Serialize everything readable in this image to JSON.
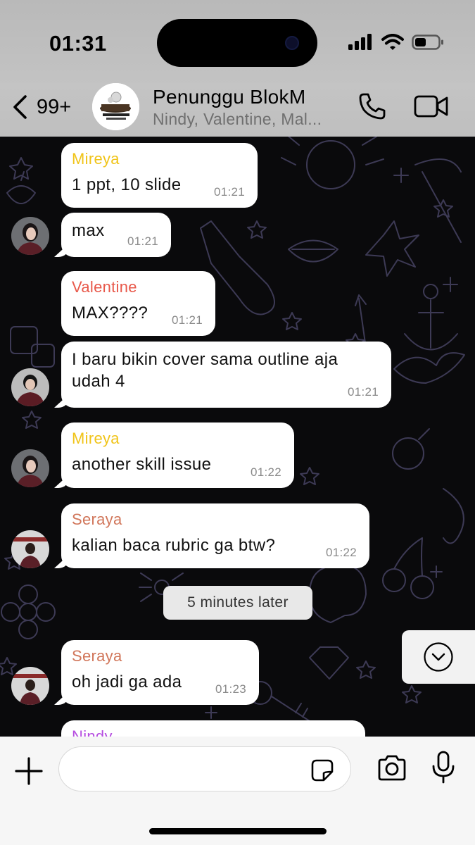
{
  "status_bar": {
    "time": "01:31",
    "icons": [
      "cellular-signal-icon",
      "wifi-icon",
      "battery-icon"
    ]
  },
  "header": {
    "back_icon": "chevron-left-icon",
    "back_count": "99+",
    "group_title": "Penunggu BlokM",
    "members_subtitle": "Nindy, Valentine, Mal...",
    "call_icon": "phone-icon",
    "video_icon": "video-camera-icon"
  },
  "messages": [
    {
      "sender": "Mireya",
      "sender_color": "#f0c419",
      "text": "1 ppt, 10 slide",
      "time": "01:21"
    },
    {
      "sender": "",
      "text": "max",
      "time": "01:21"
    },
    {
      "sender": "Valentine",
      "sender_color": "#e8584a",
      "text": "MAX????",
      "time": "01:21"
    },
    {
      "sender": "",
      "text": "I baru bikin cover sama outline aja udah 4",
      "time": "01:21"
    },
    {
      "sender": "Mireya",
      "sender_color": "#f0c419",
      "text": "another skill issue",
      "time": "01:22"
    },
    {
      "sender": "Seraya",
      "sender_color": "#d1765a",
      "text": "kalian baca rubric ga btw?",
      "time": "01:22"
    },
    {
      "sender": "Seraya",
      "sender_color": "#d1765a",
      "text": "oh jadi ga ada",
      "time": "01:23"
    },
    {
      "sender": "Nindy",
      "sender_color": "#b54ce0",
      "text": "",
      "time": ""
    }
  ],
  "system_divider": "5 minutes later",
  "composer": {
    "placeholder": "",
    "value": "",
    "icons": [
      "plus-icon",
      "sticker-icon",
      "camera-icon",
      "microphone-icon"
    ]
  },
  "colors": {
    "chat_background": "#0a0a0c",
    "bubble": "#ffffff",
    "header_background": "#c1c1c1",
    "doodle_stroke": "#3d3a55"
  }
}
